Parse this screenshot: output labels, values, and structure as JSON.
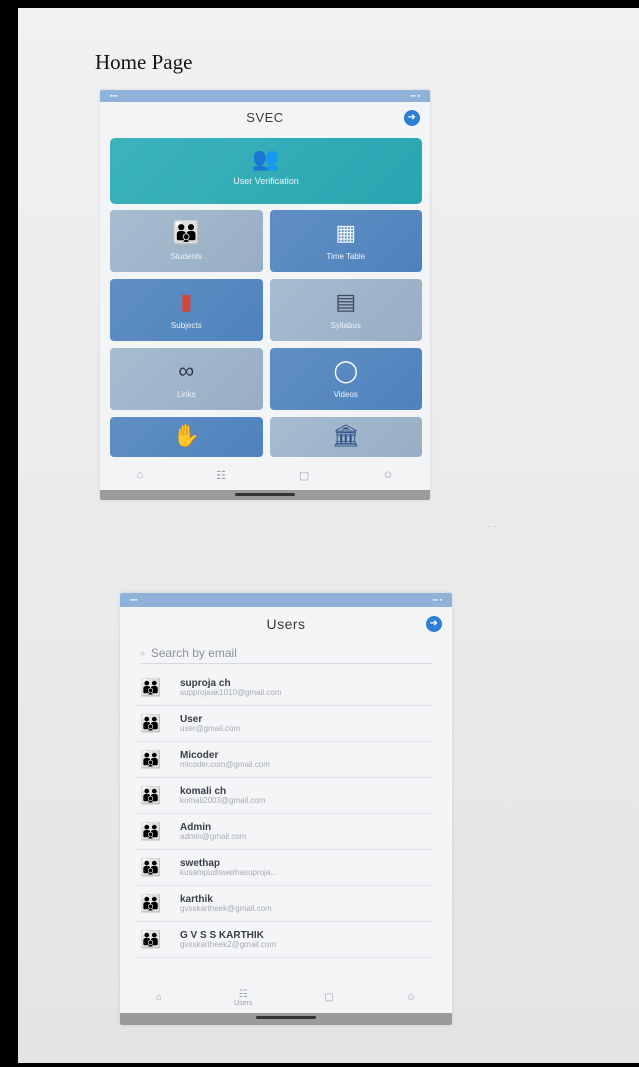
{
  "page": {
    "title": "Home Page"
  },
  "home_screen": {
    "app_title": "SVEC",
    "banner": {
      "label": "User Verification",
      "icon": "users-icon"
    },
    "tiles": [
      {
        "label": "Students",
        "icon": "people-icon",
        "tone": "grey"
      },
      {
        "label": "Time Table",
        "icon": "calendar-icon",
        "tone": "blue"
      },
      {
        "label": "Subjects",
        "icon": "book-icon",
        "tone": "blue"
      },
      {
        "label": "Syllabus",
        "icon": "document-icon",
        "tone": "grey"
      },
      {
        "label": "Links",
        "icon": "link-icon",
        "tone": "grey"
      },
      {
        "label": "Videos",
        "icon": "chat-icon",
        "tone": "blue"
      },
      {
        "label": "",
        "icon": "handshake-icon",
        "tone": "blue"
      },
      {
        "label": "",
        "icon": "bank-icon",
        "tone": "grey"
      }
    ]
  },
  "users_screen": {
    "title": "Users",
    "search_placeholder": "Search by email",
    "users": [
      {
        "name": "suproja ch",
        "email": "supprojaak1010@gmail.com"
      },
      {
        "name": "User",
        "email": "user@gmail.com"
      },
      {
        "name": "Micoder",
        "email": "micoder.com@gmail.com"
      },
      {
        "name": "komali ch",
        "email": "komali2003@gmail.com"
      },
      {
        "name": "Admin",
        "email": "admin@gmail.com"
      },
      {
        "name": "swethap",
        "email": "kusampudiswethasuproja..."
      },
      {
        "name": "karthik",
        "email": "gvsskartheek@gmail.com"
      },
      {
        "name": "G V S S KARTHIK",
        "email": "gvsskartheek2@gmail.com"
      }
    ],
    "nav": {
      "users_label": "Users"
    }
  },
  "colors": {
    "accent": "#2c7fd6",
    "teal": "#2aa4b0",
    "tile_blue": "#4f82bd",
    "tile_grey": "#97aec5"
  }
}
